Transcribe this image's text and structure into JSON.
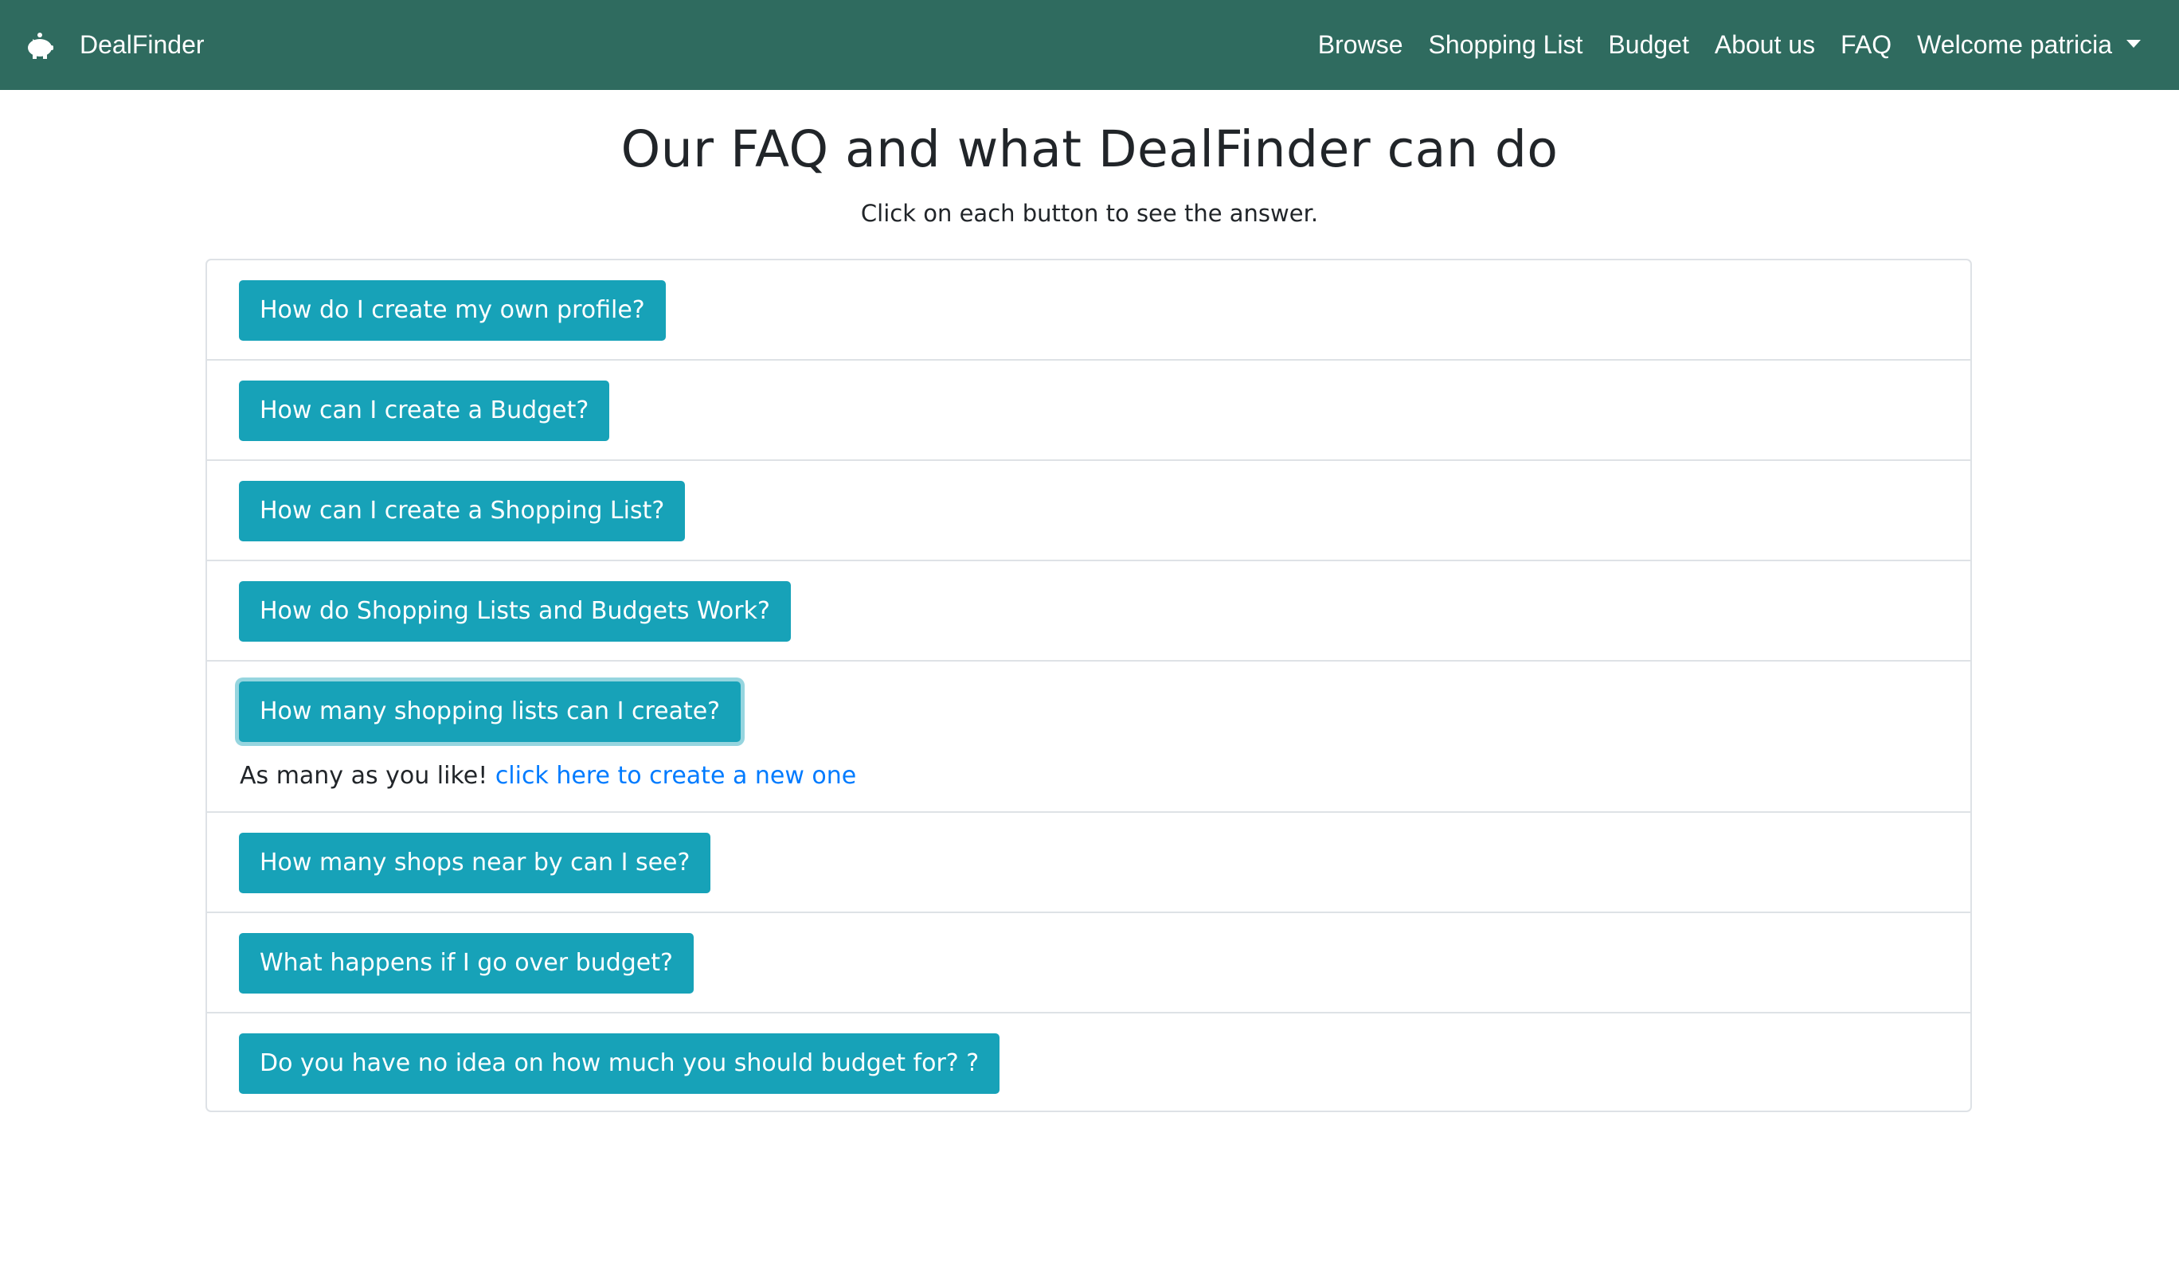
{
  "app": {
    "brand": "DealFinder",
    "brand_icon": "piggy-bank-icon"
  },
  "nav": {
    "items": [
      "Browse",
      "Shopping List",
      "Budget",
      "About us",
      "FAQ"
    ],
    "user_menu": "Welcome patricia"
  },
  "main": {
    "title": "Our FAQ and what DealFinder can do",
    "subtitle": "Click on each button to see the answer."
  },
  "faq": {
    "questions": [
      "How do I create my own profile?",
      "How can I create a Budget?",
      "How can I create a Shopping List?",
      "How do Shopping Lists and Budgets Work?",
      "How many shopping lists can I create?",
      "How many shops near by can I see?",
      "What happens if I go over budget?",
      "Do you have no idea on how much you should budget for? ?"
    ],
    "expanded_answer": {
      "text": "As many as you like! ",
      "link": "click here to create a new one"
    }
  },
  "colors": {
    "navbar": "#2f6b5f",
    "button": "#17a2b8",
    "link": "#007bff"
  }
}
